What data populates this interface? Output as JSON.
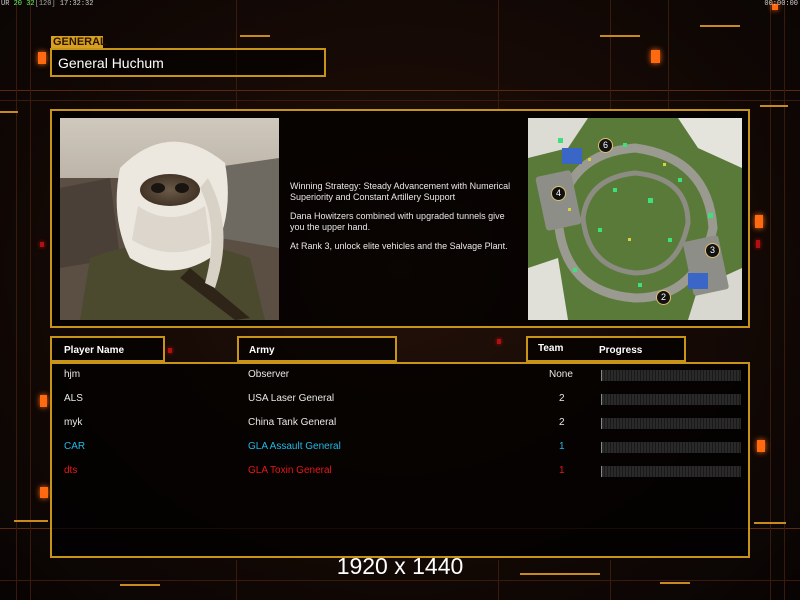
{
  "topbar": {
    "left_fps": "UR",
    "left_counts_green": "20 32",
    "left_counts_bracket": "[120]",
    "left_time": "17:32:32",
    "right_time": "00:00:00"
  },
  "general": {
    "tag": "GENERAL",
    "name": "General Huchum"
  },
  "strategy": {
    "paragraphs": [
      "Winning Strategy: Steady Advancement with Numerical\n Superiority and Constant Artillery Support",
      "Dana Howitzers combined with upgraded tunnels give\n you the upper hand.",
      "At Rank 3, unlock elite vehicles and the Salvage Plant."
    ]
  },
  "map": {
    "start_positions": [
      "6",
      "4",
      "3",
      "2"
    ]
  },
  "columns": {
    "player_name": "Player Name",
    "army": "Army",
    "team": "Team",
    "progress": "Progress"
  },
  "players": [
    {
      "name": "hjm",
      "army": "Observer",
      "team": "None",
      "color": "#e8e8e8",
      "progress": 0
    },
    {
      "name": "ALS",
      "army": "USA Laser General",
      "team": "2",
      "color": "#e8e8e8",
      "progress": 0
    },
    {
      "name": "myk",
      "army": "China Tank General",
      "team": "2",
      "color": "#e8e8e8",
      "progress": 0
    },
    {
      "name": "CAR",
      "army": "GLA Assault General",
      "team": "1",
      "color": "#22b8e8",
      "progress": 0
    },
    {
      "name": "dts",
      "army": "GLA Toxin General",
      "team": "1",
      "color": "#e81818",
      "progress": 0
    }
  ],
  "watermark": "1920 x 1440",
  "colors": {
    "frame": "#c89418",
    "accent": "#ff6a10"
  }
}
